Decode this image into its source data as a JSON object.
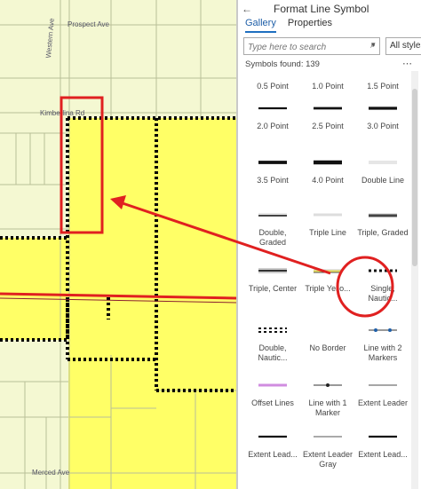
{
  "map": {
    "road_labels": [
      "Prospect Ave",
      "Western Ave",
      "Kimberlina Rd",
      "Merced Ave"
    ]
  },
  "panel": {
    "title": "Format Line Symbol",
    "tabs": [
      {
        "label": "Gallery",
        "active": true
      },
      {
        "label": "Properties",
        "active": false
      }
    ],
    "search_placeholder": "Type here to search",
    "styles_label": "All styles",
    "symbols_found": "Symbols found: 139",
    "symbols": [
      {
        "label": "0.5 Point",
        "style": "solid",
        "weight": 0.5
      },
      {
        "label": "1.0 Point",
        "style": "solid",
        "weight": 1
      },
      {
        "label": "1.5 Point",
        "style": "solid",
        "weight": 1.5
      },
      {
        "label": "2.0 Point",
        "style": "solid",
        "weight": 2
      },
      {
        "label": "2.5 Point",
        "style": "solid",
        "weight": 2.5
      },
      {
        "label": "3.0 Point",
        "style": "solid",
        "weight": 3
      },
      {
        "label": "3.5 Point",
        "style": "solid",
        "weight": 3.5
      },
      {
        "label": "4.0 Point",
        "style": "solid",
        "weight": 4
      },
      {
        "label": "Double Line",
        "style": "double",
        "weight": 1
      },
      {
        "label": "Double, Graded",
        "style": "graded",
        "weight": 2
      },
      {
        "label": "Triple Line",
        "style": "triple",
        "weight": 1
      },
      {
        "label": "Triple, Graded",
        "style": "graded",
        "weight": 3
      },
      {
        "label": "Triple, Center",
        "style": "triplecenter",
        "weight": 2
      },
      {
        "label": "Triple Yello...",
        "style": "tripleyellow",
        "weight": 2
      },
      {
        "label": "Single, Nautic...",
        "style": "nautical",
        "weight": 2
      },
      {
        "label": "Double, Nautic...",
        "style": "doublenautical",
        "weight": 2
      },
      {
        "label": "No Border",
        "style": "none",
        "weight": 0
      },
      {
        "label": "Line with 2 Markers",
        "style": "markers2",
        "weight": 1
      },
      {
        "label": "Offset Lines",
        "style": "offset",
        "weight": 1
      },
      {
        "label": "Line with 1 Marker",
        "style": "marker1",
        "weight": 1
      },
      {
        "label": "Extent Leader",
        "style": "extent",
        "weight": 1
      },
      {
        "label": "Extent Lead...",
        "style": "solid",
        "weight": 2
      },
      {
        "label": "Extent Leader Gray",
        "style": "gray",
        "weight": 2
      },
      {
        "label": "Extent Lead...",
        "style": "solid",
        "weight": 2
      }
    ]
  },
  "colors": {
    "map_background": "#f4f8d2",
    "parcel_fill": "#ffff66",
    "annotation_red": "#e02020",
    "accent_blue": "#1f6fc0"
  }
}
